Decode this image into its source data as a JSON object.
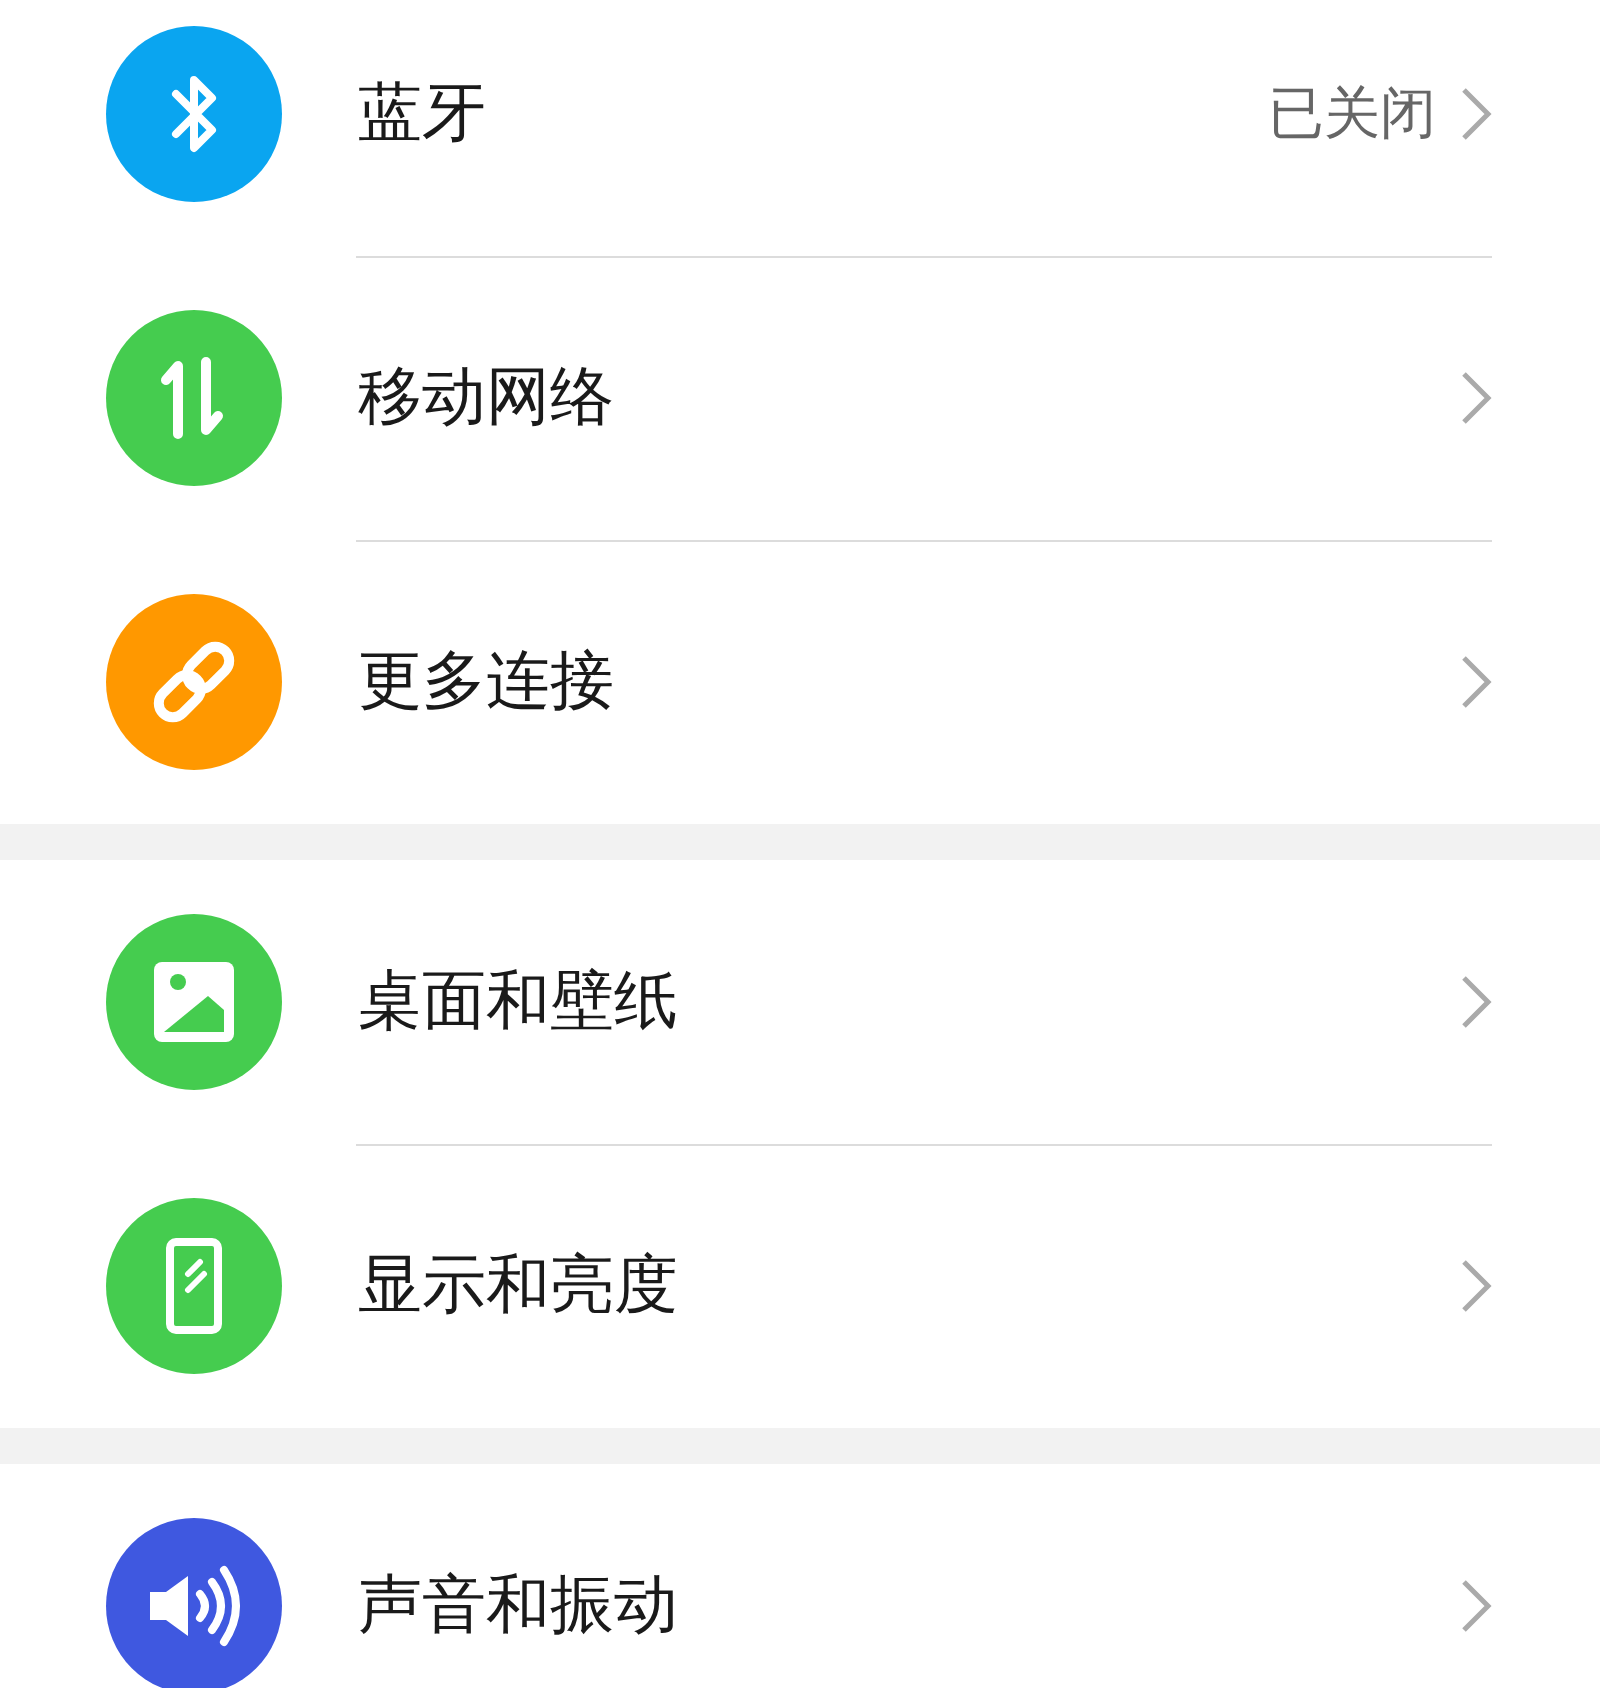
{
  "sections": [
    {
      "items": [
        {
          "kind": "bluetooth",
          "color": "#0aa5f0",
          "label": "蓝牙",
          "value": "已关闭"
        },
        {
          "kind": "data",
          "color": "#45cc4f",
          "label": "移动网络"
        },
        {
          "kind": "link",
          "color": "#ff9800",
          "label": "更多连接"
        }
      ]
    },
    {
      "items": [
        {
          "kind": "image",
          "color": "#45cc4f",
          "label": "桌面和壁纸"
        },
        {
          "kind": "phone",
          "color": "#45cc4f",
          "label": "显示和亮度"
        }
      ]
    },
    {
      "items": [
        {
          "kind": "sound",
          "color": "#3f58e0",
          "label": "声音和振动"
        }
      ]
    }
  ]
}
